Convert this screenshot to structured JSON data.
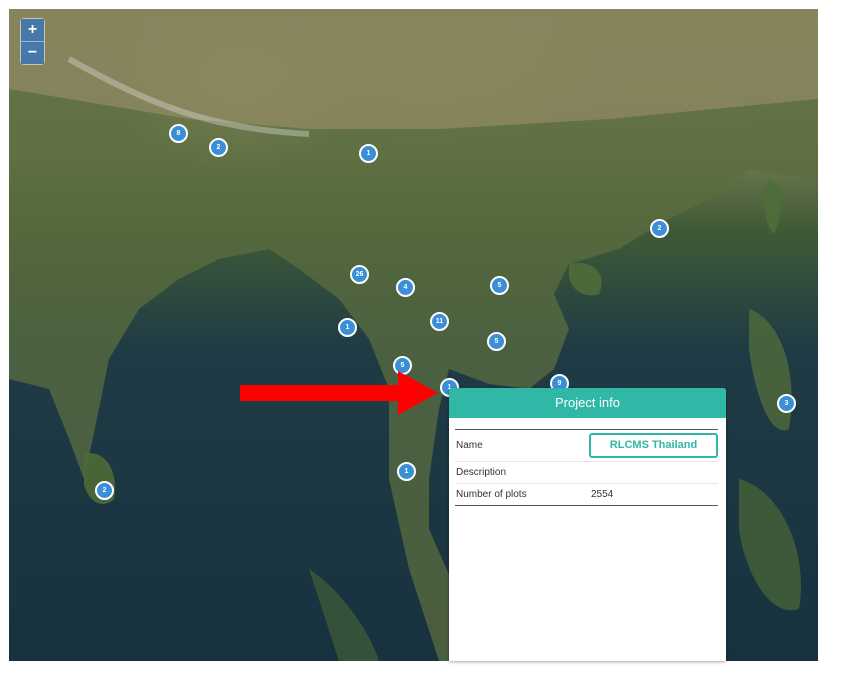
{
  "map": {
    "zoom_in_label": "+",
    "zoom_out_label": "−",
    "clusters": [
      "8",
      "2",
      "1",
      "2",
      "26",
      "4",
      "5",
      "11",
      "1",
      "5",
      "5",
      "1",
      "9",
      "3",
      "1",
      "2"
    ]
  },
  "project_info": {
    "title": "Project info",
    "name_label": "Name",
    "name_value": "RLCMS Thailand",
    "description_label": "Description",
    "description_value": "",
    "plots_label": "Number of plots",
    "plots_value": "2554"
  },
  "colors": {
    "accent": "#31b7a6",
    "cluster": "#3a8fd6",
    "arrow": "#ff0000"
  }
}
